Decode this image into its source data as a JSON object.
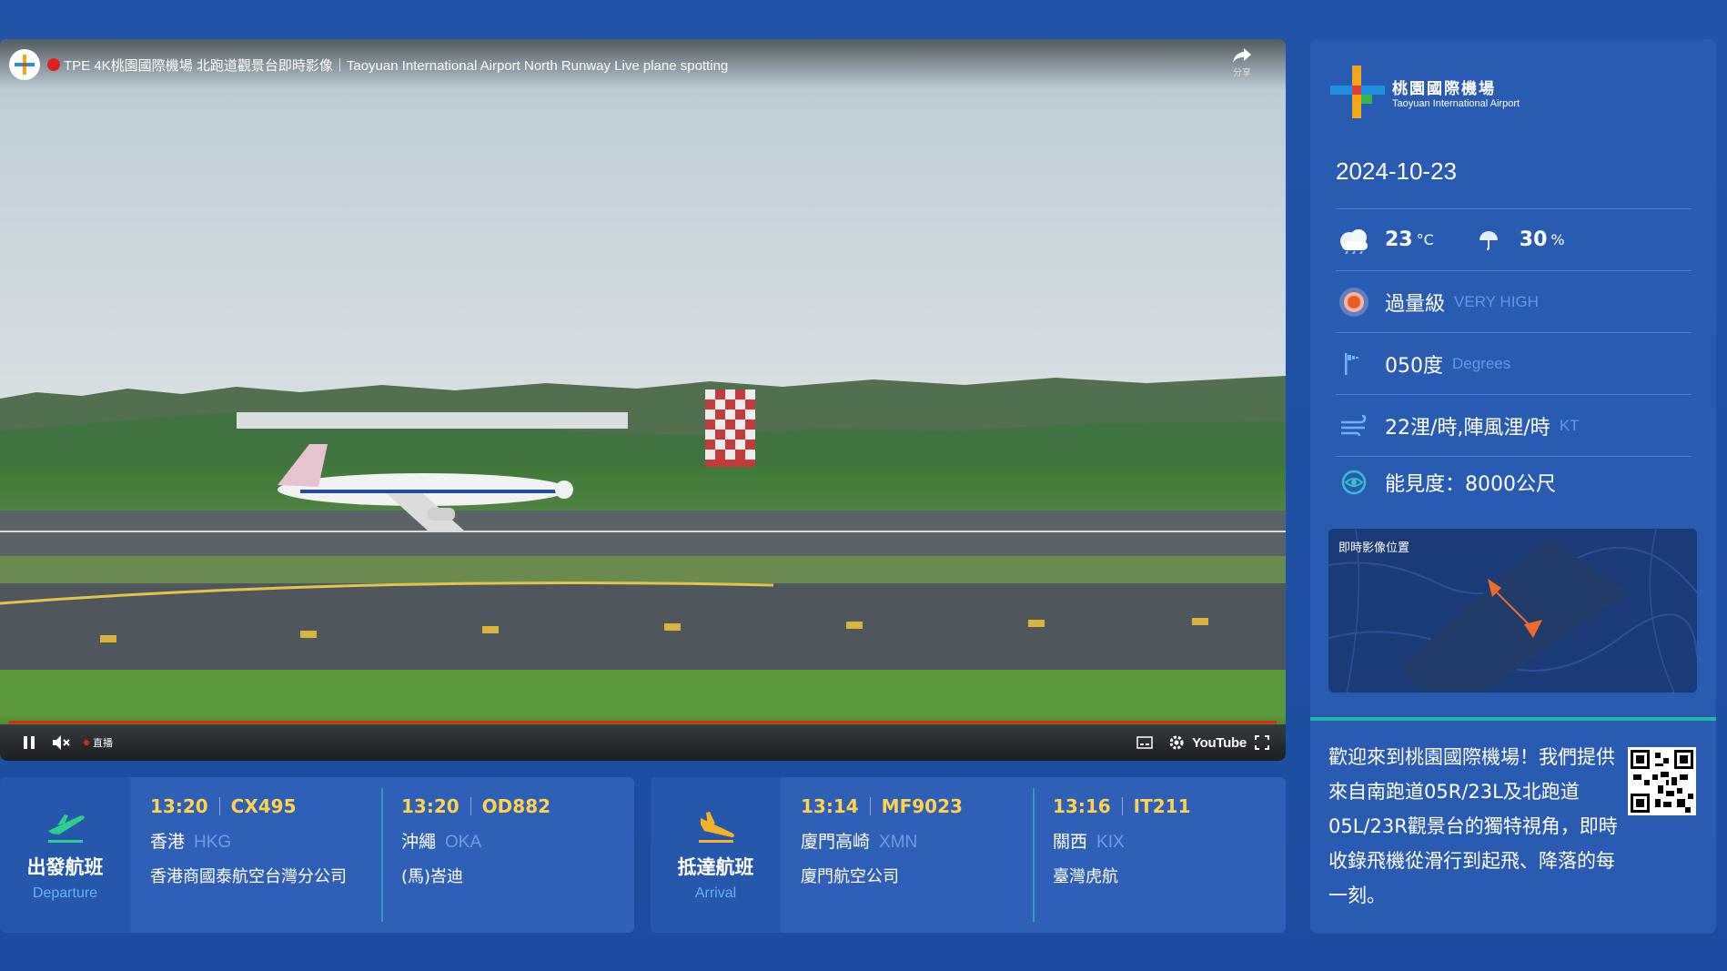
{
  "video": {
    "title": "TPE 4K桃園國際機場 北跑道觀景台即時影像｜Taoyuan International Airport North Runway Live plane spotting",
    "share_label": "分享",
    "live_label": "直播",
    "youtube_label": "YouTube",
    "progress": 1.0
  },
  "departure": {
    "title_zh": "出發航班",
    "title_en": "Departure",
    "flights": [
      {
        "time": "13:20",
        "flight": "CX495",
        "city": "香港",
        "code": "HKG",
        "airline": "香港商國泰航空台灣分公司"
      },
      {
        "time": "13:20",
        "flight": "OD882",
        "city": "沖繩",
        "code": "OKA",
        "airline": "(馬)峇迪"
      }
    ]
  },
  "arrival": {
    "title_zh": "抵達航班",
    "title_en": "Arrival",
    "flights": [
      {
        "time": "13:14",
        "flight": "MF9023",
        "city": "廈門高崎",
        "code": "XMN",
        "airline": "廈門航空公司"
      },
      {
        "time": "13:16",
        "flight": "IT211",
        "city": "關西",
        "code": "KIX",
        "airline": "臺灣虎航"
      }
    ]
  },
  "sidebar": {
    "brand_zh": "桃園國際機場",
    "brand_en": "Taoyuan International Airport",
    "date": "2024-10-23",
    "weather": {
      "temp": "23",
      "temp_unit": "°C",
      "rain": "30",
      "rain_unit": "%"
    },
    "uv": {
      "level": "過量級",
      "level_en": "VERY HIGH"
    },
    "wind_dir": {
      "value": "050度",
      "unit": "Degrees"
    },
    "wind_speed": {
      "value": "22浬/時,陣風浬/時",
      "unit": "KT"
    },
    "visibility": {
      "value": "能見度：8000公尺"
    },
    "map_title": "即時影像位置",
    "welcome": "歡迎來到桃園國際機場！我們提供來自南跑道05R/23L及北跑道05L/23R觀景台的獨特視角，即時收錄飛機從滑行到起飛、降落的每一刻。"
  },
  "colors": {
    "background": "#1f4fa3",
    "panel": "#2a5bb3",
    "flight_number": "#ffd34d",
    "code_text": "#6e9de6",
    "accent_teal": "#1fb8a6",
    "live_red": "#e62117"
  }
}
